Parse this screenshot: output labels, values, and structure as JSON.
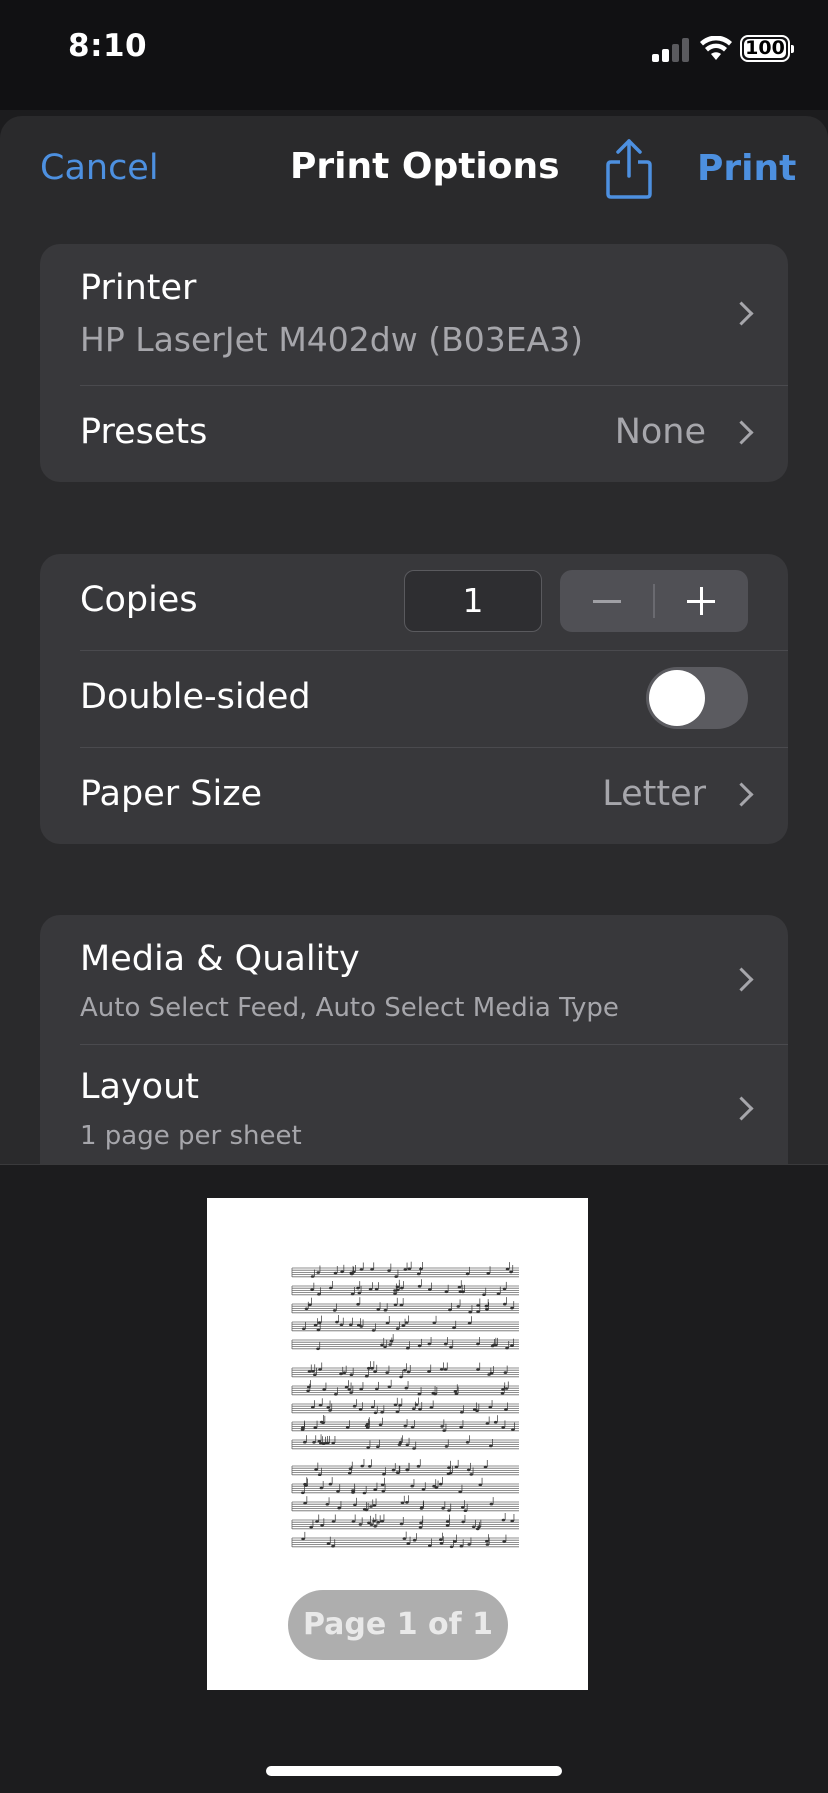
{
  "status_bar": {
    "time": "8:10",
    "battery": "100"
  },
  "nav": {
    "cancel": "Cancel",
    "title": "Print Options",
    "share_icon": "share-icon",
    "print": "Print"
  },
  "printer_group": {
    "printer_label": "Printer",
    "printer_name": "HP LaserJet M402dw (B03EA3)",
    "presets_label": "Presets",
    "presets_value": "None"
  },
  "copies_group": {
    "copies_label": "Copies",
    "copies_value": "1",
    "double_sided_label": "Double-sided",
    "double_sided_on": false,
    "paper_size_label": "Paper Size",
    "paper_size_value": "Letter"
  },
  "options_group": {
    "media_label": "Media & Quality",
    "media_sub": "Auto Select Feed, Auto Select Media Type",
    "layout_label": "Layout",
    "layout_sub": "1 page per sheet"
  },
  "preview": {
    "page_indicator": "Page 1 of 1"
  },
  "colors": {
    "accent": "#4d90e0",
    "background": "#1c1c1e",
    "cell": "#38383b"
  }
}
